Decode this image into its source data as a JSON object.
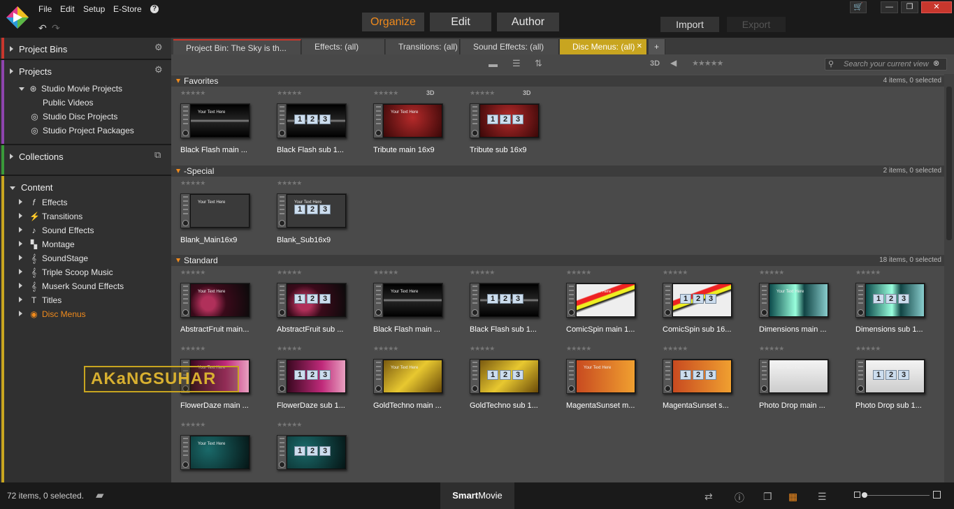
{
  "app": {
    "menu": [
      "File",
      "Edit",
      "Setup",
      "E-Store"
    ],
    "help": "?",
    "modes": [
      "Organize",
      "Edit",
      "Author"
    ],
    "active_mode": "Organize",
    "import_label": "Import",
    "export_label": "Export",
    "accent": "#f08a1c"
  },
  "sidebar": {
    "bins_label": "Project Bins",
    "projects_label": "Projects",
    "projects_items": [
      "Studio Movie Projects",
      "Public Videos",
      "Studio Disc Projects",
      "Studio Project Packages"
    ],
    "collections_label": "Collections",
    "content_label": "Content",
    "content_items": [
      {
        "label": "Effects",
        "icon": "fx-icon"
      },
      {
        "label": "Transitions",
        "icon": "lightning-icon"
      },
      {
        "label": "Sound Effects",
        "icon": "note-icon"
      },
      {
        "label": "Montage",
        "icon": "montage-icon"
      },
      {
        "label": "SoundStage",
        "icon": "clef-icon"
      },
      {
        "label": "Triple Scoop Music",
        "icon": "clef-icon"
      },
      {
        "label": "Muserk Sound Effects",
        "icon": "clef-icon"
      },
      {
        "label": "Titles",
        "icon": "title-icon"
      },
      {
        "label": "Disc Menus",
        "icon": "disc-icon"
      }
    ],
    "selected": "Disc Menus"
  },
  "tabs": [
    "Project Bin: The Sky is th...",
    "Effects: (all)",
    "Transitions: (all)",
    "Sound Effects: (all)",
    "Disc Menus: (all)"
  ],
  "active_tab": "Disc Menus: (all)",
  "toolbar": {
    "three_d": "3D",
    "search_placeholder": "Search your current view"
  },
  "groups": [
    {
      "title": "Favorites",
      "count": "4 items, 0 selected"
    },
    {
      "title": "-Special",
      "count": "2 items, 0 selected"
    },
    {
      "title": "Standard",
      "count": "18 items, 0 selected"
    }
  ],
  "favorites": [
    {
      "label": "Black Flash main ...",
      "d3": ""
    },
    {
      "label": "Black Flash sub 1...",
      "d3": ""
    },
    {
      "label": "Tribute main 16x9",
      "d3": "3D"
    },
    {
      "label": "Tribute sub 16x9",
      "d3": "3D"
    }
  ],
  "special": [
    {
      "label": "Blank_Main16x9"
    },
    {
      "label": "Blank_Sub16x9"
    }
  ],
  "standard": [
    {
      "label": "AbstractFruit main..."
    },
    {
      "label": "AbstractFruit sub ..."
    },
    {
      "label": "Black Flash main ..."
    },
    {
      "label": "Black Flash sub 1..."
    },
    {
      "label": "ComicSpin main 1..."
    },
    {
      "label": "ComicSpin sub 16..."
    },
    {
      "label": "Dimensions main ..."
    },
    {
      "label": "Dimensions sub 1..."
    },
    {
      "label": "FlowerDaze main ..."
    },
    {
      "label": "FlowerDaze sub 1..."
    },
    {
      "label": "GoldTechno main ..."
    },
    {
      "label": "GoldTechno sub 1..."
    },
    {
      "label": "MagentaSunset m..."
    },
    {
      "label": "MagentaSunset s..."
    },
    {
      "label": "Photo Drop main ..."
    },
    {
      "label": "Photo Drop sub 1..."
    },
    {
      "label": ""
    },
    {
      "label": ""
    }
  ],
  "status": {
    "items_text": "72 items, 0 selected.",
    "smart_bold": "Smart",
    "smart_rest": "Movie"
  },
  "watermark": "AKaNGSUHAR"
}
